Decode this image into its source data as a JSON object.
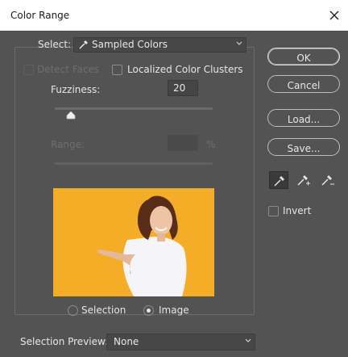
{
  "window": {
    "title": "Color Range"
  },
  "select": {
    "label": "Select:",
    "value": "Sampled Colors"
  },
  "detect_faces": {
    "label": "Detect Faces",
    "checked": false,
    "enabled": false
  },
  "localized_clusters": {
    "label": "Localized Color Clusters",
    "checked": false
  },
  "fuzziness": {
    "label": "Fuzziness:",
    "value": "20",
    "slider_fraction": 0.1
  },
  "range": {
    "label": "Range:",
    "value": "",
    "unit": "%",
    "enabled": false
  },
  "preview_mode": {
    "options": [
      {
        "label": "Selection",
        "selected": false
      },
      {
        "label": "Image",
        "selected": true
      }
    ]
  },
  "buttons": {
    "ok": "OK",
    "cancel": "Cancel",
    "load": "Load...",
    "save": "Save..."
  },
  "eyedroppers": [
    {
      "icon": "eyedropper-icon",
      "active": true
    },
    {
      "icon": "eyedropper-plus-icon",
      "active": false
    },
    {
      "icon": "eyedropper-minus-icon",
      "active": false
    }
  ],
  "invert": {
    "label": "Invert",
    "checked": false
  },
  "selection_preview": {
    "label": "Selection Preview:",
    "value": "None"
  },
  "colors": {
    "background": "#535353",
    "titlebar": "#ffffff",
    "preview_bg": "#f3ad27"
  }
}
